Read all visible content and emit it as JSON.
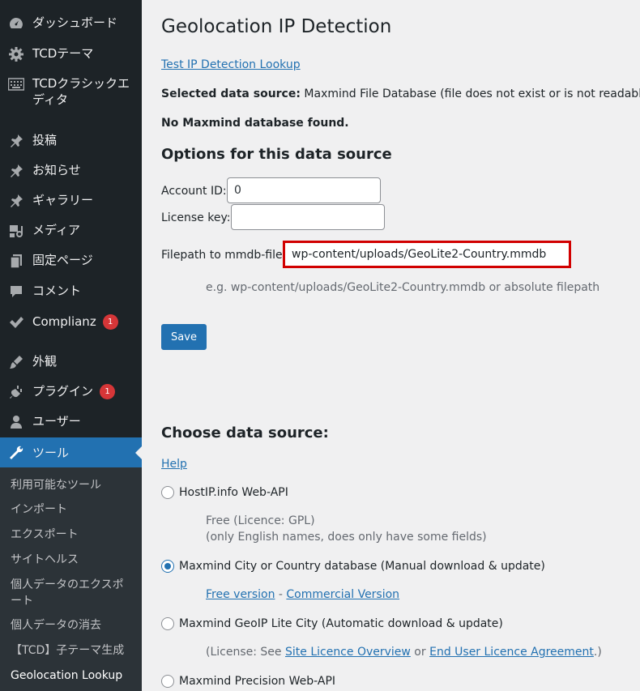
{
  "sidebar": {
    "items": [
      {
        "label": "ダッシュボード",
        "icon": "dashboard-icon"
      },
      {
        "label": "TCDテーマ",
        "icon": "gear-icon"
      },
      {
        "label": "TCDクラシックエディタ",
        "icon": "keyboard-icon"
      },
      {
        "label": "投稿",
        "icon": "pin-icon"
      },
      {
        "label": "お知らせ",
        "icon": "pin-icon"
      },
      {
        "label": "ギャラリー",
        "icon": "pin-icon"
      },
      {
        "label": "メディア",
        "icon": "media-icon"
      },
      {
        "label": "固定ページ",
        "icon": "page-icon"
      },
      {
        "label": "コメント",
        "icon": "comment-icon"
      },
      {
        "label": "Complianz",
        "icon": "check-icon",
        "badge": "1"
      },
      {
        "label": "外観",
        "icon": "brush-icon"
      },
      {
        "label": "プラグイン",
        "icon": "plugin-icon",
        "badge": "1"
      },
      {
        "label": "ユーザー",
        "icon": "user-icon"
      },
      {
        "label": "ツール",
        "icon": "wrench-icon"
      }
    ],
    "submenu": [
      "利用可能なツール",
      "インポート",
      "エクスポート",
      "サイトヘルス",
      "個人データのエクスポート",
      "個人データの消去",
      "【TCD】子テーマ生成",
      "Geolocation Lookup"
    ]
  },
  "main": {
    "title": "Geolocation IP Detection",
    "test_link": "Test IP Detection Lookup",
    "selected_source_label": "Selected data source:",
    "selected_source_value": "Maxmind File Database (file does not exist or is not readable)",
    "no_db": "No Maxmind database found.",
    "options_heading": "Options for this data source",
    "account_id_label": "Account ID:",
    "account_id_value": "0",
    "license_key_label": "License key:",
    "license_key_value": "",
    "filepath_label": "Filepath to mmdb-file:",
    "filepath_value": "wp-content/uploads/GeoLite2-Country.mmdb",
    "filepath_hint": "e.g. wp-content/uploads/GeoLite2-Country.mmdb or absolute filepath",
    "save_label": "Save",
    "choose_heading": "Choose data source:",
    "help_link": "Help",
    "sources": [
      {
        "label": "HostIP.info Web-API",
        "checked": false,
        "desc1": "Free (Licence: GPL)",
        "desc2": "(only English names, does only have some fields)"
      },
      {
        "label": "Maxmind City or Country database (Manual download & update)",
        "checked": true,
        "link1": "Free version",
        "sep": " - ",
        "link2": "Commercial Version"
      },
      {
        "label": "Maxmind GeoIP Lite City (Automatic download & update)",
        "checked": false,
        "prefix": "(License: See ",
        "link1": "Site Licence Overview",
        "mid": " or ",
        "link2": "End User Licence Agreement",
        "suffix": ".)"
      },
      {
        "label": "Maxmind Precision Web-API",
        "checked": true
      }
    ]
  }
}
